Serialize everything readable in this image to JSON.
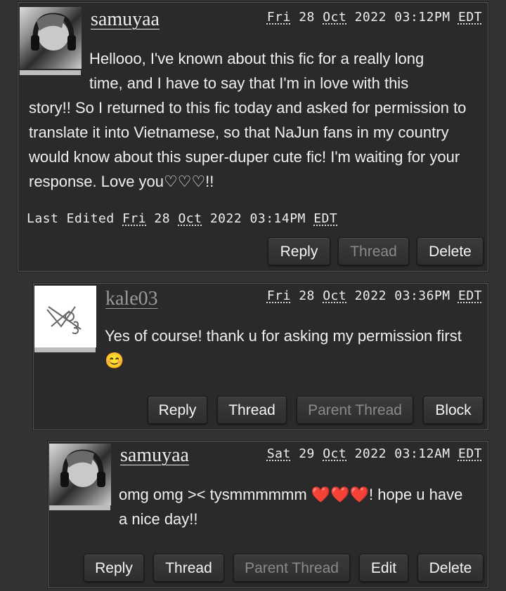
{
  "comments": [
    {
      "author": "samuyaa",
      "date": {
        "weekday": "Fri",
        "day": "28",
        "month": "Oct",
        "year": "2022",
        "time": "03:12PM",
        "tz": "EDT"
      },
      "text_line1": "Hellooo, I've known about this fic for a really long",
      "text_line2": "time, and I have to say that I'm in love with this",
      "text_rest": "story!! So I returned to this fic today and asked for permission to translate it into Vietnamese, so that NaJun fans in my country would know about this super-duper cute fic! I'm waiting for your response. Love you♡♡♡!!",
      "edited": {
        "label": "Last Edited",
        "weekday": "Fri",
        "day": "28",
        "month": "Oct",
        "year": "2022",
        "time": "03:14PM",
        "tz": "EDT"
      },
      "actions": [
        "Reply",
        "Thread",
        "Delete"
      ]
    },
    {
      "author": "kale03",
      "date": {
        "weekday": "Fri",
        "day": "28",
        "month": "Oct",
        "year": "2022",
        "time": "03:36PM",
        "tz": "EDT"
      },
      "text": "Yes of course! thank u for asking my permission first😊",
      "actions": [
        "Reply",
        "Thread",
        "Parent Thread",
        "Block"
      ]
    },
    {
      "author": "samuyaa",
      "date": {
        "weekday": "Sat",
        "day": "29",
        "month": "Oct",
        "year": "2022",
        "time": "03:12AM",
        "tz": "EDT"
      },
      "text": "omg omg >< tysmmmmmm ❤️❤️❤️! hope u have a nice day!!",
      "actions": [
        "Reply",
        "Thread",
        "Parent Thread",
        "Edit",
        "Delete"
      ]
    }
  ],
  "colors": {
    "background": "#333333",
    "panel": "#2a2a2a",
    "disabled_text": "#8a8a8a"
  }
}
